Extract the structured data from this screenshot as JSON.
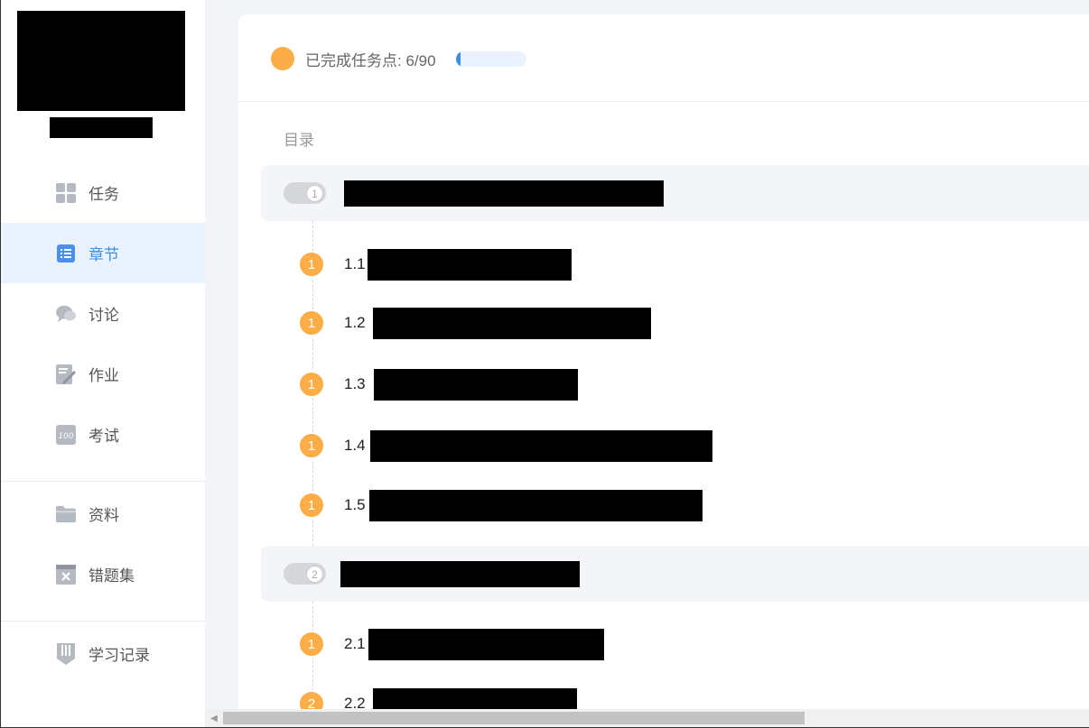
{
  "sidebar": {
    "nav_items": [
      {
        "label": "任务",
        "icon": "grid-icon"
      },
      {
        "label": "章节",
        "icon": "list-icon",
        "active": true
      },
      {
        "label": "讨论",
        "icon": "chat-icon"
      },
      {
        "label": "作业",
        "icon": "edit-icon"
      },
      {
        "label": "考试",
        "icon": "exam-icon"
      }
    ],
    "nav_items_2": [
      {
        "label": "资料",
        "icon": "folder-icon"
      },
      {
        "label": "错题集",
        "icon": "wrong-questions-icon"
      }
    ],
    "nav_items_3": [
      {
        "label": "学习记录",
        "icon": "record-icon"
      }
    ]
  },
  "progress": {
    "text": "已完成任务点: 6/90",
    "fraction": 0.067
  },
  "toc": {
    "title": "目录",
    "chapters": [
      {
        "num": "1",
        "sections": [
          {
            "badge": "1",
            "num": "1.1"
          },
          {
            "badge": "1",
            "num": "1.2"
          },
          {
            "badge": "1",
            "num": "1.3"
          },
          {
            "badge": "1",
            "num": "1.4"
          },
          {
            "badge": "1",
            "num": "1.5"
          }
        ]
      },
      {
        "num": "2",
        "sections": [
          {
            "badge": "1",
            "num": "2.1"
          },
          {
            "badge": "2",
            "num": "2.2"
          }
        ]
      }
    ]
  },
  "colors": {
    "accent": "#3a8ee6",
    "badge": "#fbae47",
    "active_bg": "#eaf3fd"
  }
}
